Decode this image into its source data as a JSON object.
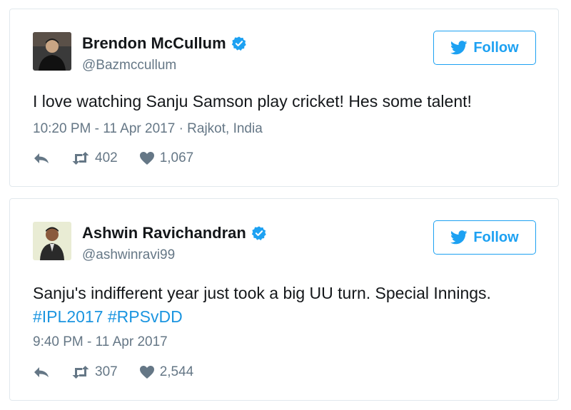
{
  "colors": {
    "brand_blue": "#1da1f2",
    "link_blue": "#1b95e0",
    "meta_gray": "#657786",
    "text_dark": "#14171a",
    "border": "#e1e8ed"
  },
  "tweets": [
    {
      "display_name": "Brendon McCullum",
      "handle": "@Bazmccullum",
      "verified_icon": "verified-badge-icon",
      "follow_label": "Follow",
      "text": "I love watching Sanju Samson play cricket! Hes some talent!",
      "time": "10:20 PM - 11 Apr 2017",
      "location": "Rajkot, India",
      "retweets": "402",
      "likes": "1,067"
    },
    {
      "display_name": "Ashwin Ravichandran",
      "handle": "@ashwinravi99",
      "verified_icon": "verified-badge-icon",
      "follow_label": "Follow",
      "text": "Sanju's indifferent year just took a big UU turn. Special Innings.",
      "hashtags": "#IPL2017 #RPSvDD",
      "time": "9:40 PM - 11 Apr 2017",
      "retweets": "307",
      "likes": "2,544"
    }
  ]
}
